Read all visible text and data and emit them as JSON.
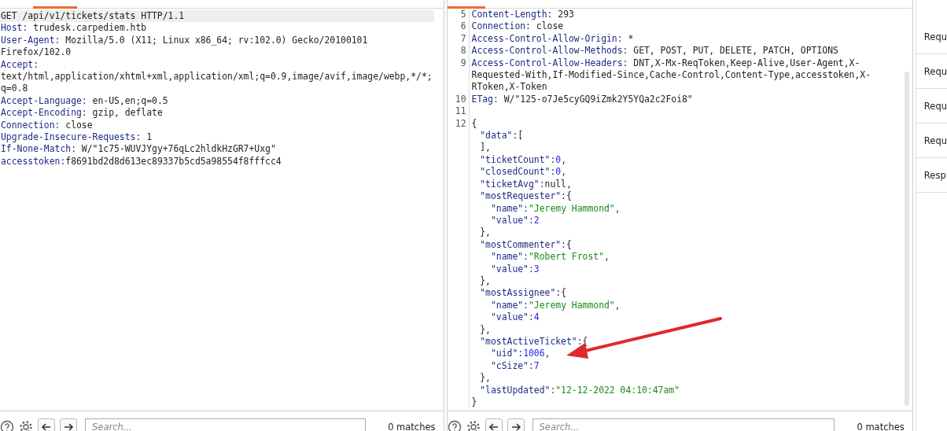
{
  "request": {
    "lines": [
      {
        "value": "GET /api/v1/tickets/stats HTTP/1.1",
        "selected": true
      },
      {
        "name": "Host:",
        "value": " trudesk.carpediem.htb",
        "selected": false
      },
      {
        "name": "User-Agent:",
        "value": " Mozilla/5.0 (X11; Linux x86_64; rv:102.0) Gecko/20100101 Firefox/102.0",
        "selected": false
      },
      {
        "name": "Accept:",
        "value": " text/html,application/xhtml+xml,application/xml;q=0.9,image/avif,image/webp,*/*;q=0.8",
        "selected": false
      },
      {
        "name": "Accept-Language:",
        "value": " en-US,en;q=0.5",
        "selected": false
      },
      {
        "name": "Accept-Encoding:",
        "value": " gzip, deflate",
        "selected": false
      },
      {
        "name": "Connection:",
        "value": " close",
        "selected": false
      },
      {
        "name": "Upgrade-Insecure-Requests:",
        "value": " 1",
        "selected": false
      },
      {
        "name": "If-None-Match:",
        "value": " W/\"1c75-WUVJYgy+76qLc2hldkHzGR7+Uxg\"",
        "selected": false
      },
      {
        "name": "accesstoken:",
        "value": "f8691bd2d8d613ec89337b5cd5a98554f8fffcc4",
        "selected": false
      }
    ],
    "search": {
      "placeholder": "Search...",
      "matches": "0 matches"
    }
  },
  "response": {
    "headers": [
      {
        "number": "5",
        "name": "Content-Length:",
        "value": " 293"
      },
      {
        "number": "6",
        "name": "Connection:",
        "value": " close"
      },
      {
        "number": "7",
        "name": "Access-Control-Allow-Origin:",
        "value": " *"
      },
      {
        "number": "8",
        "name": "Access-Control-Allow-Methods:",
        "value": " GET, POST, PUT, DELETE, PATCH, OPTIONS"
      },
      {
        "number": "9",
        "name": "Access-Control-Allow-Headers:",
        "value": " DNT,X-Mx-ReqToken,Keep-Alive,User-Agent,X-Requested-With,If-Modified-Since,Cache-Control,Content-Type,accesstoken,X-RToken,X-Token"
      },
      {
        "number": "10",
        "name": "ETag:",
        "value": " W/\"125-o7Je5cyGQ9iZmk2Y5YQa2c2Foi8\""
      }
    ],
    "blank_number": "11",
    "body_number": "12",
    "body": {
      "open": "{",
      "close": "}",
      "entries": [
        {
          "kind": "array",
          "key": "\"data\":",
          "value": "[",
          "close": "],"
        },
        {
          "kind": "number",
          "key": "\"ticketCount\":",
          "value": "0",
          "comma": ","
        },
        {
          "kind": "number",
          "key": "\"closedCount\":",
          "value": "0",
          "comma": ","
        },
        {
          "kind": "null",
          "key": "\"ticketAvg\":",
          "value": "null",
          "comma": ","
        },
        {
          "kind": "object",
          "key": "\"mostRequester\":",
          "value": "{",
          "close": "},",
          "children": [
            {
              "kind": "string",
              "key": "\"name\":",
              "value": "\"Jeremy Hammond\"",
              "comma": ","
            },
            {
              "kind": "number",
              "key": "\"value\":",
              "value": "2"
            }
          ]
        },
        {
          "kind": "object",
          "key": "\"mostCommenter\":",
          "value": "{",
          "close": "},",
          "children": [
            {
              "kind": "string",
              "key": "\"name\":",
              "value": "\"Robert Frost\"",
              "comma": ","
            },
            {
              "kind": "number",
              "key": "\"value\":",
              "value": "3"
            }
          ]
        },
        {
          "kind": "object",
          "key": "\"mostAssignee\":",
          "value": "{",
          "close": "},",
          "children": [
            {
              "kind": "string",
              "key": "\"name\":",
              "value": "\"Jeremy Hammond\"",
              "comma": ","
            },
            {
              "kind": "number",
              "key": "\"value\":",
              "value": "4"
            }
          ]
        },
        {
          "kind": "object",
          "key": "\"mostActiveTicket\":",
          "value": "{",
          "close": "},",
          "children": [
            {
              "kind": "number",
              "key": "\"uid\":",
              "value": "1006",
              "comma": ","
            },
            {
              "kind": "number",
              "key": "\"cSize\":",
              "value": "7"
            }
          ]
        },
        {
          "kind": "string",
          "key": "\"lastUpdated\":",
          "value": "\"12-12-2022 04:10:47am\""
        }
      ]
    },
    "search": {
      "placeholder": "Search...",
      "matches": "0 matches"
    }
  },
  "sidebar": {
    "items": [
      "Requ",
      "Requ",
      "Requ",
      "Requ",
      "Resp"
    ]
  }
}
